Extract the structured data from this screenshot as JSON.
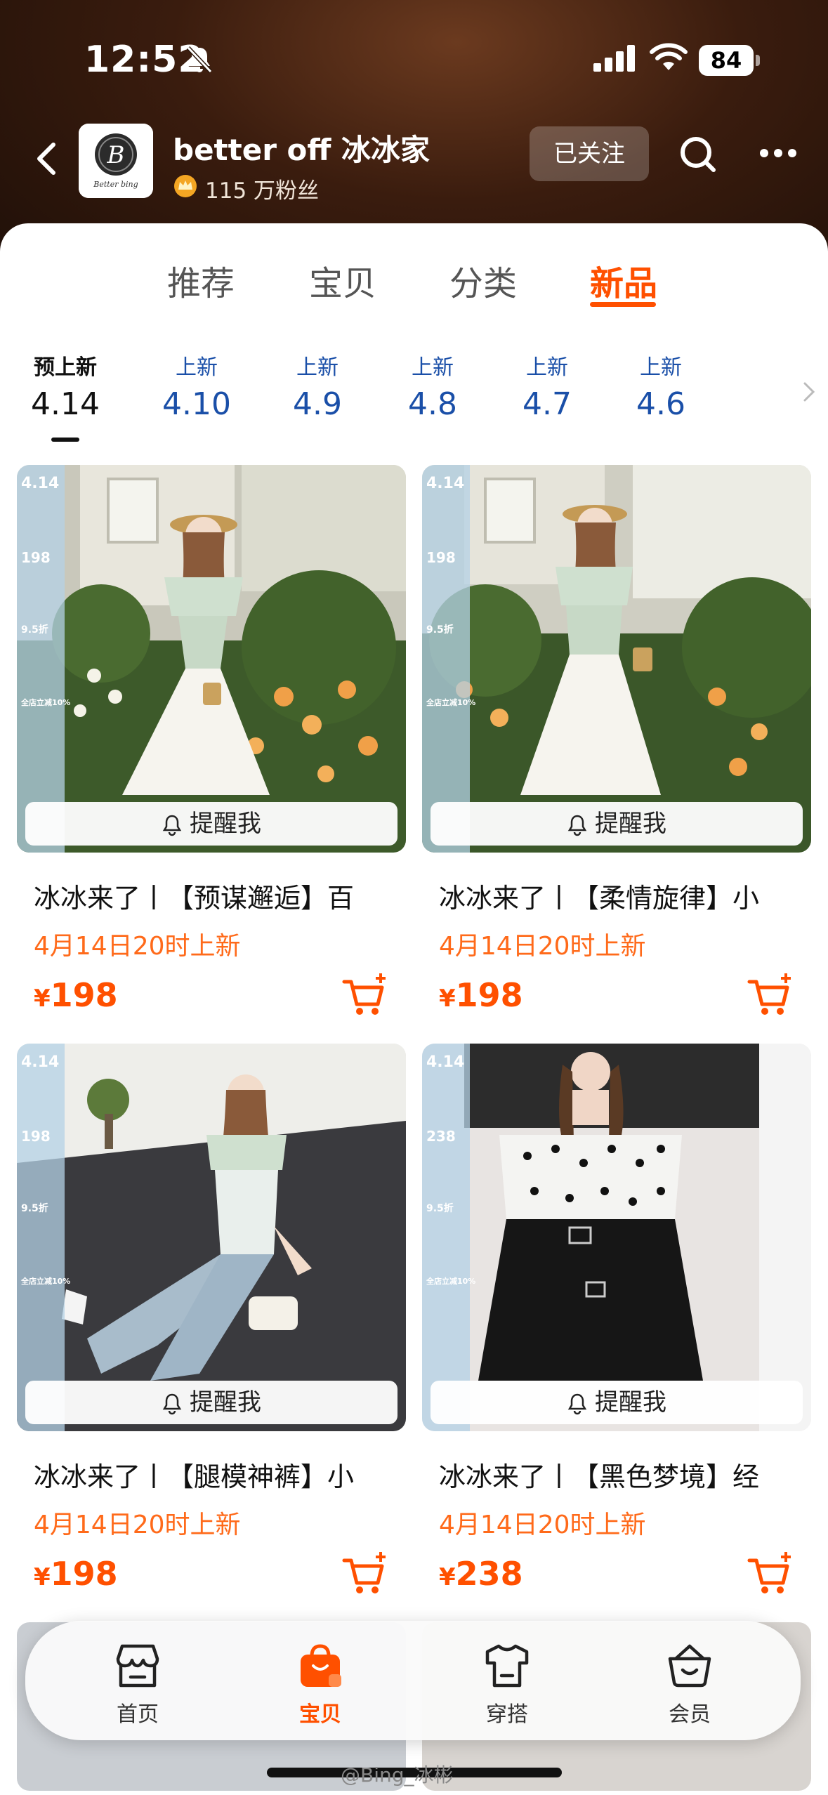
{
  "status_bar": {
    "time": "12:52",
    "battery": "84"
  },
  "shop": {
    "name": "better off 冰冰家",
    "fans": "115 万粉丝",
    "follow_label": "已关注",
    "logo_text": "Better bing"
  },
  "main_tabs": [
    {
      "label": "推荐",
      "active": false
    },
    {
      "label": "宝贝",
      "active": false
    },
    {
      "label": "分类",
      "active": false
    },
    {
      "label": "新品",
      "active": true
    }
  ],
  "date_tabs": [
    {
      "label": "预上新",
      "date": "4.14",
      "active": true
    },
    {
      "label": "上新",
      "date": "4.10"
    },
    {
      "label": "上新",
      "date": "4.9"
    },
    {
      "label": "上新",
      "date": "4.8"
    },
    {
      "label": "上新",
      "date": "4.7"
    },
    {
      "label": "上新",
      "date": "4.6"
    }
  ],
  "products": [
    {
      "title": "冰冰来了丨【预谋邂逅】百",
      "launch": "4月14日20时上新",
      "currency": "¥",
      "price": "198",
      "remind": "提醒我",
      "promo": {
        "date": "4.14",
        "price": "198",
        "discount": "9.5折",
        "tag": "全店立减10%"
      }
    },
    {
      "title": "冰冰来了丨【柔情旋律】小",
      "launch": "4月14日20时上新",
      "currency": "¥",
      "price": "198",
      "remind": "提醒我",
      "promo": {
        "date": "4.14",
        "price": "198",
        "discount": "9.5折",
        "tag": "全店立减10%"
      }
    },
    {
      "title": "冰冰来了丨【腿模神裤】小",
      "launch": "4月14日20时上新",
      "currency": "¥",
      "price": "198",
      "remind": "提醒我",
      "promo": {
        "date": "4.14",
        "price": "198",
        "discount": "9.5折",
        "tag": "全店立减10%"
      }
    },
    {
      "title": "冰冰来了丨【黑色梦境】经",
      "launch": "4月14日20时上新",
      "currency": "¥",
      "price": "238",
      "remind": "提醒我",
      "promo": {
        "date": "4.14",
        "price": "238",
        "discount": "9.5折",
        "tag": "全店立减10%"
      }
    }
  ],
  "bottom_nav": [
    {
      "label": "首页",
      "icon": "storefront-icon"
    },
    {
      "label": "宝贝",
      "icon": "shopping-bag-icon",
      "active": true
    },
    {
      "label": "穿搭",
      "icon": "tshirt-icon"
    },
    {
      "label": "会员",
      "icon": "member-basket-icon"
    }
  ],
  "watermark": "@Bing_冰彬",
  "colors": {
    "accent": "#ff5000",
    "date_blue": "#1a4fa8"
  }
}
